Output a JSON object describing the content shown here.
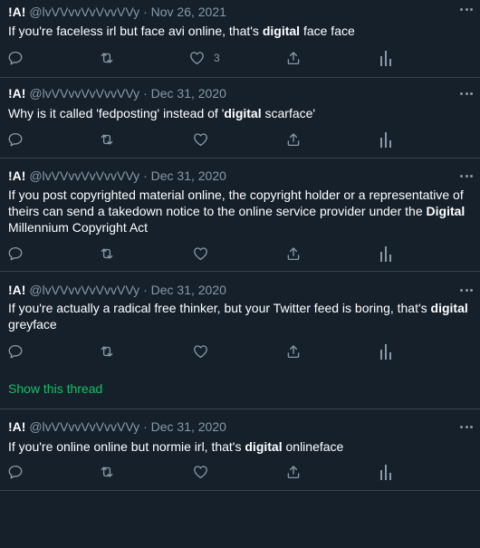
{
  "colors": {
    "background": "#15202b",
    "divider": "#38444d",
    "secondary_text": "#8899a6",
    "primary_text": "#ffffff",
    "thread_link": "#17bf63"
  },
  "icons": [
    "reply-icon",
    "retweet-icon",
    "like-icon",
    "share-icon",
    "analytics-icon",
    "more-icon"
  ],
  "tweets": [
    {
      "name": "!A!",
      "handle": "@lvVVvvVvVvvVVy",
      "sep": "·",
      "date": "Nov 26, 2021",
      "text_parts": [
        "If you're faceless irl but face avi online, that's ",
        "digital",
        " face face"
      ],
      "likes": "3"
    },
    {
      "name": "!A!",
      "handle": "@lvVVvvVvVvvVVy",
      "sep": "·",
      "date": "Dec 31, 2020",
      "text_parts": [
        "Why is it called 'fedposting' instead of '",
        "digital",
        " scarface'"
      ],
      "likes": ""
    },
    {
      "name": "!A!",
      "handle": "@lvVVvvVvVvvVVy",
      "sep": "·",
      "date": "Dec 31, 2020",
      "text_parts": [
        "If you post copyrighted material online, the copyright holder or a representative of theirs can send a takedown notice to the online service provider under the ",
        "Digital",
        " Millennium Copyright Act"
      ],
      "likes": ""
    },
    {
      "name": "!A!",
      "handle": "@lvVVvvVvVvvVVy",
      "sep": "·",
      "date": "Dec 31, 2020",
      "text_parts": [
        "If you're actually a radical free thinker, but your Twitter feed is boring, that's ",
        "digital",
        " greyface"
      ],
      "likes": "",
      "show_thread": "Show this thread"
    },
    {
      "name": "!A!",
      "handle": "@lvVVvvVvVvvVVy",
      "sep": "·",
      "date": "Dec 31, 2020",
      "text_parts": [
        "If you're online online but normie irl, that's ",
        "digital",
        " onlineface"
      ],
      "likes": ""
    }
  ]
}
